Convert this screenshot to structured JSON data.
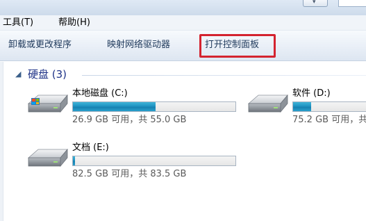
{
  "menubar": {
    "items": [
      {
        "label": "工具(T)"
      },
      {
        "label": "帮助(H)"
      }
    ]
  },
  "toolbar": {
    "uninstall_label": "卸载或更改程序",
    "map_drive_label": "映射网络驱动器",
    "control_panel_label": "打开控制面板"
  },
  "group": {
    "title": "硬盘 (3)"
  },
  "drives": [
    {
      "name": "本地磁盘 (C:)",
      "free_text": "26.9 GB 可用，共 55.0 GB",
      "used_fraction": 0.51
    },
    {
      "name": "软件 (D:)",
      "free_text": "75.2 GB 可用，共",
      "used_fraction": 0.24
    },
    {
      "name": "文档 (E:)",
      "free_text": "82.5 GB 可用，共 83.5 GB",
      "used_fraction": 0.012
    }
  ],
  "colors": {
    "highlight_box": "#d4232f",
    "usage_bar": "#1f93c2",
    "group_title": "#1e3287",
    "toolbar_text": "#1e395b"
  },
  "icons": {
    "nav": "chevron-down-icon",
    "group": "collapse-chevron-icon",
    "drive": "hard-drive-icon",
    "system_drive": "windows-hard-drive-icon"
  }
}
